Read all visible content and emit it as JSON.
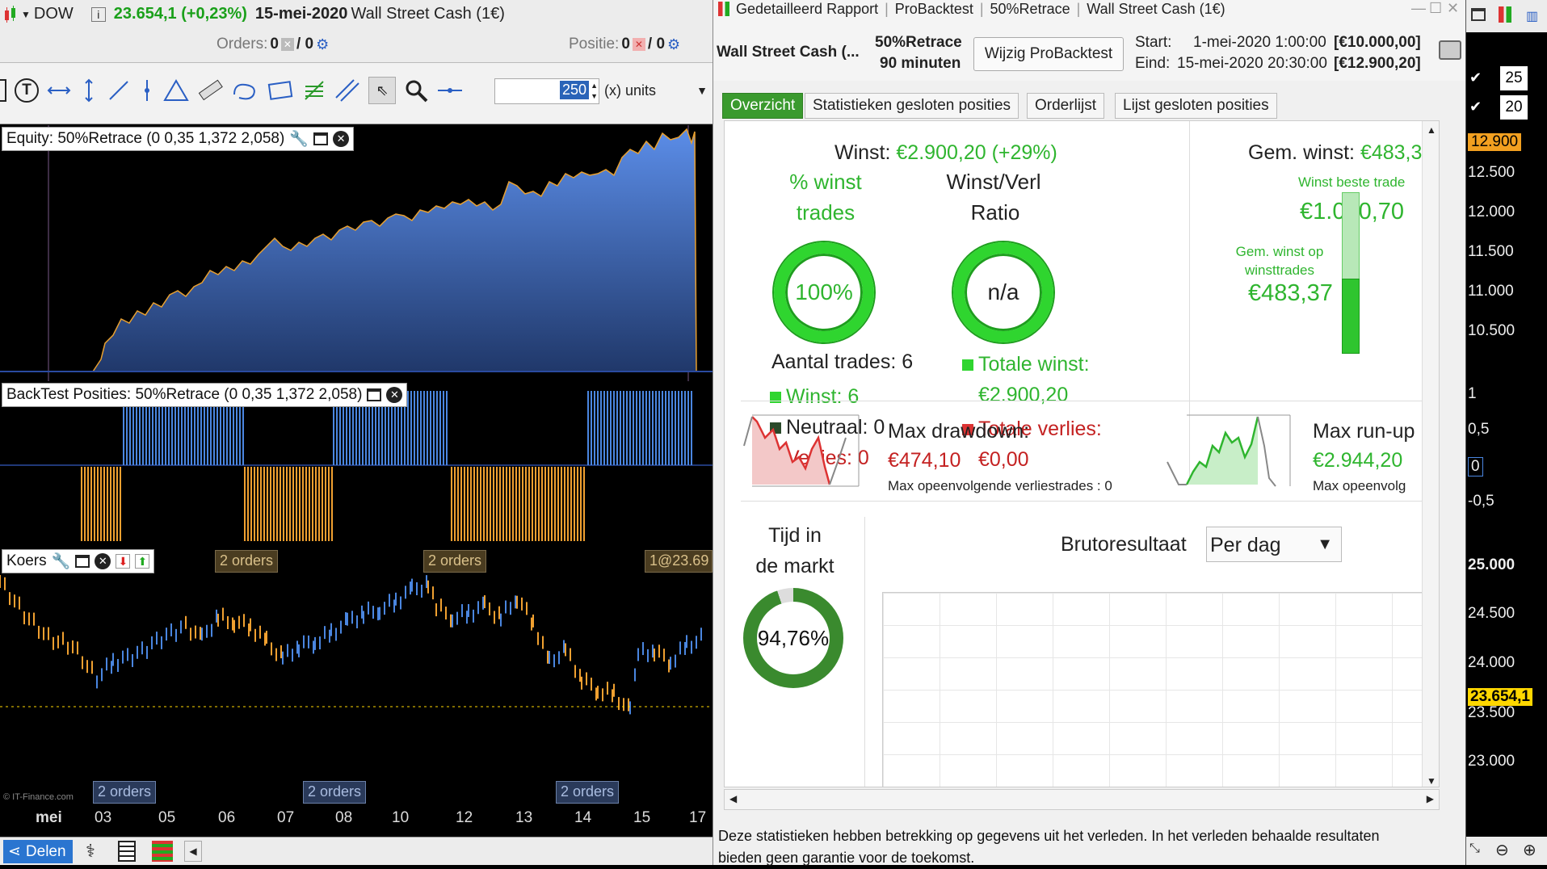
{
  "left": {
    "symbol": "DOW",
    "price_change": "23.654,1 (+0,23%)",
    "date": "15-mei-2020",
    "instrument": "Wall Street Cash (1€)",
    "orders_label": "Orders:",
    "orders_count": "0",
    "orders_count2": "/ 0",
    "position_label": "Positie:",
    "position_count": "0",
    "position_count2": "/ 0",
    "units_value": "250",
    "units_label": "(x) units",
    "equity_title": "Equity: 50%Retrace (0 0,35 1,372 2,058)",
    "positions_title": "BackTest Posities: 50%Retrace (0 0,35 1,372 2,058)",
    "price_title": "Koers",
    "orders_tags_top": [
      "2 orders",
      "2 orders"
    ],
    "price_tag_right": "1@23.69",
    "orders_tags_bottom": [
      "2 orders",
      "2 orders",
      "2 orders"
    ],
    "watermark": "© IT-Finance.com",
    "x_labels": [
      "mei",
      "03",
      "05",
      "06",
      "07",
      "08",
      "10",
      "12",
      "13",
      "14",
      "15",
      "17"
    ],
    "share_label": "Delen"
  },
  "report": {
    "window_title_parts": [
      "Gedetailleerd Rapport",
      "ProBacktest",
      "50%Retrace",
      "Wall Street Cash (1€)"
    ],
    "instrument": "Wall Street Cash (...",
    "strategy": "50%Retrace",
    "timeframe": "90 minuten",
    "modify_button": "Wijzig ProBacktest",
    "start_label": "Start:",
    "start_value": "1-mei-2020 1:00:00",
    "start_capital": "[€10.000,00]",
    "end_label": "Eind:",
    "end_value": "15-mei-2020 20:30:00",
    "end_capital": "[€12.900,20]",
    "tabs": [
      "Overzicht",
      "Statistieken gesloten posities",
      "Orderlijst",
      "Lijst gesloten posities"
    ],
    "profit_label": "Winst:",
    "profit_value": "€2.900,20 (+29%)",
    "pct_winning_label_1": "% winst",
    "pct_winning_label_2": "trades",
    "pct_winning_value": "100%",
    "ratio_label_1": "Winst/Verl",
    "ratio_label_2": "Ratio",
    "ratio_value": "n/a",
    "trades_count_label": "Aantal trades: 6",
    "win_count": "Winst: 6",
    "neutral_count": "Neutraal: 0",
    "loss_count": "Verlies: 0",
    "total_profit_label": "Totale winst:",
    "total_profit_value": "€2.900,20",
    "total_loss_label": "Totale verlies:",
    "total_loss_value": "€0,00",
    "avg_profit_label": "Gem. winst:",
    "avg_profit_value": "€483,3",
    "best_trade_label": "Winst beste trade",
    "best_trade_value": "€1.040,70",
    "avg_win_label_1": "Gem. winst op",
    "avg_win_label_2": "winsttrades",
    "avg_win_value": "€483,37",
    "max_dd_label": "Max drawdown:",
    "max_dd_value": "€474,10",
    "max_dd_sub": "Max opeenvolgende verliestrades : 0",
    "max_ru_label": "Max run-up",
    "max_ru_value": "€2.944,20",
    "max_ru_sub": "Max opeenvolg",
    "time_label_1": "Tijd in",
    "time_label_2": "de markt",
    "time_value": "94,76%",
    "time_fraction": 0.9476,
    "gross_label": "Brutoresultaat",
    "gross_select": "Per dag",
    "footer_text_1": "Deze statistieken hebben betrekking op gegevens uit het verleden. In het verleden behaalde resultaten",
    "footer_text_2": "bieden geen garantie voor de toekomst."
  },
  "far_right": {
    "top_values": [
      "25",
      "20"
    ],
    "equity_ticks": [
      "12.900",
      "12.500",
      "12.000",
      "11.500",
      "11.000",
      "10.500"
    ],
    "position_ticks": [
      "1",
      "0,5",
      "0",
      "-0,5"
    ],
    "price_ticks": [
      "25.000",
      "24.500",
      "24.000",
      "23.654,1",
      "23.500",
      "23.000"
    ]
  },
  "colors": {
    "accent_green": "#2fb52f",
    "tab_active": "#3a9a2e",
    "loss_red": "#c42121",
    "equity_blue": "#4a7fd4",
    "position_long": "#4a86e0",
    "position_short": "#f0a030",
    "last_price": "#ffd700"
  }
}
